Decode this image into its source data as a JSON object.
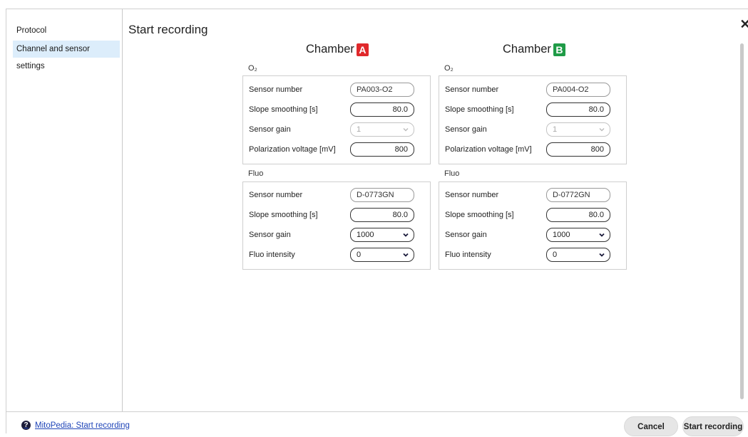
{
  "sidebar": {
    "items": [
      {
        "label": "Protocol",
        "active": false
      },
      {
        "label": "Channel and sensor settings",
        "active": true
      }
    ]
  },
  "dialog": {
    "title": "Start recording",
    "close_icon": "close-icon"
  },
  "chambers": [
    {
      "label": "Chamber",
      "badge": "A",
      "badge_color": "#e0282b",
      "o2": {
        "section_label": "O₂",
        "sensor_number": {
          "label": "Sensor number",
          "value": "PA003-O2"
        },
        "slope_smoothing": {
          "label": "Slope smoothing [s]",
          "value": "80.0"
        },
        "sensor_gain": {
          "label": "Sensor gain",
          "value": "1"
        },
        "polarization": {
          "label": "Polarization voltage [mV]",
          "value": "800"
        }
      },
      "fluo": {
        "section_label": "Fluo",
        "sensor_number": {
          "label": "Sensor number",
          "value": "D-0773GN"
        },
        "slope_smoothing": {
          "label": "Slope smoothing [s]",
          "value": "80.0"
        },
        "sensor_gain": {
          "label": "Sensor gain",
          "value": "1000"
        },
        "intensity": {
          "label": "Fluo intensity",
          "value": "0"
        }
      }
    },
    {
      "label": "Chamber",
      "badge": "B",
      "badge_color": "#1f9b47",
      "o2": {
        "section_label": "O₂",
        "sensor_number": {
          "label": "Sensor number",
          "value": "PA004-O2"
        },
        "slope_smoothing": {
          "label": "Slope smoothing [s]",
          "value": "80.0"
        },
        "sensor_gain": {
          "label": "Sensor gain",
          "value": "1"
        },
        "polarization": {
          "label": "Polarization voltage [mV]",
          "value": "800"
        }
      },
      "fluo": {
        "section_label": "Fluo",
        "sensor_number": {
          "label": "Sensor number",
          "value": "D-0772GN"
        },
        "slope_smoothing": {
          "label": "Slope smoothing [s]",
          "value": "80.0"
        },
        "sensor_gain": {
          "label": "Sensor gain",
          "value": "1000"
        },
        "intensity": {
          "label": "Fluo intensity",
          "value": "0"
        }
      }
    }
  ],
  "footer": {
    "help_link": "MitoPedia: Start recording",
    "cancel_label": "Cancel",
    "start_label": "Start recording"
  },
  "colors": {
    "active_item_bg": "#dcedfb",
    "link": "#1f45b8"
  }
}
